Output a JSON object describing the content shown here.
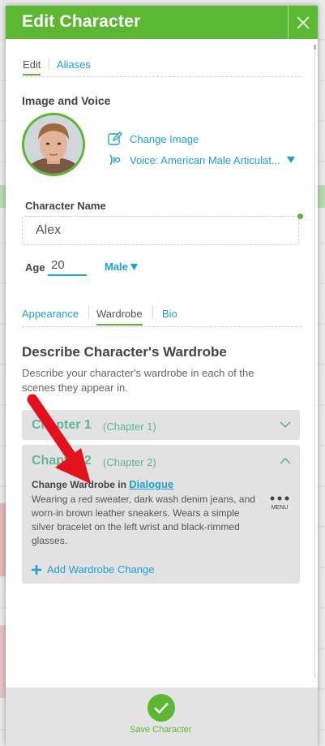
{
  "modal": {
    "title": "Edit Character"
  },
  "top_tabs": [
    {
      "label": "Edit"
    },
    {
      "label": "Aliases"
    }
  ],
  "image_voice": {
    "heading": "Image and Voice",
    "change_image": "Change Image",
    "voice": "Voice: American Male Articulat..."
  },
  "character_name": {
    "label": "Character Name",
    "value": "Alex"
  },
  "age": {
    "label": "Age",
    "value": "20"
  },
  "gender": {
    "value": "Male"
  },
  "sub_tabs": [
    {
      "label": "Appearance"
    },
    {
      "label": "Wardrobe"
    },
    {
      "label": "Bio"
    }
  ],
  "wardrobe": {
    "heading": "Describe Character's Wardrobe",
    "description": "Describe your character's wardrobe in each of the scenes they appear in.",
    "chapters": [
      {
        "title": "Chapter 1",
        "subtitle": "(Chapter 1)"
      },
      {
        "title": "Chapter 2",
        "subtitle": "(Chapter 2)"
      }
    ],
    "change_prefix": "Change Wardrobe in",
    "change_link": "Dialogue",
    "change_text": "Wearing a red sweater, dark wash denim jeans, and worn-in brown leather sneakers. Wears a simple silver bracelet on the left wrist and black-rimmed glasses.",
    "menu_label": "MENU",
    "add_change": "Add Wardrobe Change"
  },
  "footer": {
    "save_label": "Save Character"
  },
  "colors": {
    "accent_green": "#5cb833",
    "link_blue": "#1aa3d6",
    "arrow_red": "#e3111b",
    "card_grey": "#e2e2e2"
  },
  "icons": [
    "close-icon",
    "pencil-icon",
    "voice-icon",
    "caret-down-icon",
    "chevron-down-icon",
    "chevron-up-icon",
    "plus-icon",
    "dots-menu-icon",
    "checkmark-icon",
    "annotation-arrow"
  ]
}
